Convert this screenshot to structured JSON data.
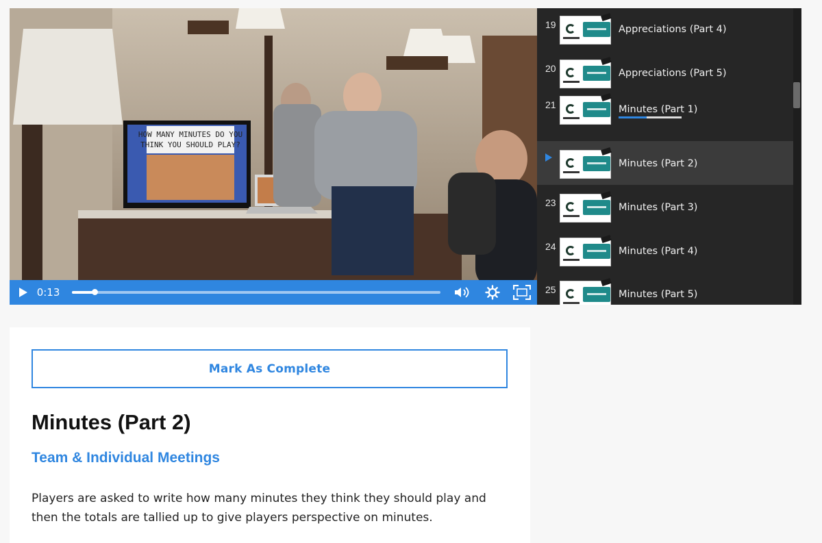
{
  "video": {
    "time": "0:13",
    "progress_fraction": 0.06,
    "screen_text_line1": "HOW MANY MINUTES DO YOU",
    "screen_text_line2": "THINK YOU SHOULD PLAY?"
  },
  "playlist": {
    "items": [
      {
        "number": "19",
        "title": "Appreciations (Part 4)",
        "active": false
      },
      {
        "number": "20",
        "title": "Appreciations (Part 5)",
        "active": false
      },
      {
        "number": "21",
        "title": "Minutes (Part 1)",
        "active": false,
        "watched_fraction": 0.45
      },
      {
        "number": "",
        "title": "Minutes (Part 2)",
        "active": true
      },
      {
        "number": "23",
        "title": "Minutes (Part 3)",
        "active": false
      },
      {
        "number": "24",
        "title": "Minutes (Part 4)",
        "active": false
      },
      {
        "number": "25",
        "title": "Minutes (Part 5)",
        "active": false
      }
    ]
  },
  "lesson": {
    "complete_label": "Mark As Complete",
    "title": "Minutes (Part 2)",
    "category": "Team & Individual Meetings",
    "description": "Players are asked to write how many minutes they think they should play and then the totals are tallied up to give players perspective on minutes."
  },
  "colors": {
    "accent": "#2f86e0",
    "playlist_bg": "#262626"
  }
}
